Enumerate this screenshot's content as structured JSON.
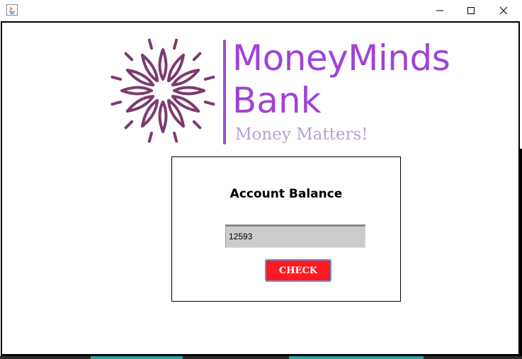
{
  "window": {
    "icon": "java-app-icon",
    "controls": {
      "minimize_icon": "minimize-icon",
      "maximize_icon": "maximize-icon",
      "close_icon": "close-icon"
    }
  },
  "logo": {
    "brand_name_line1": "MoneyMinds",
    "brand_name_line2": "Bank",
    "tagline": "Money Matters!",
    "icon": "starburst-logo-icon",
    "colors": {
      "brand_text": "#a043d4",
      "tagline_text": "#b7a0d3",
      "starburst": "#7b3b6e"
    }
  },
  "balance_panel": {
    "title": "Account Balance",
    "balance_value": "12593",
    "check_button_label": "CHECK",
    "colors": {
      "button_background": "#ff1a1f",
      "button_border": "#6b8fd6",
      "field_background": "#cbcbcb"
    }
  }
}
